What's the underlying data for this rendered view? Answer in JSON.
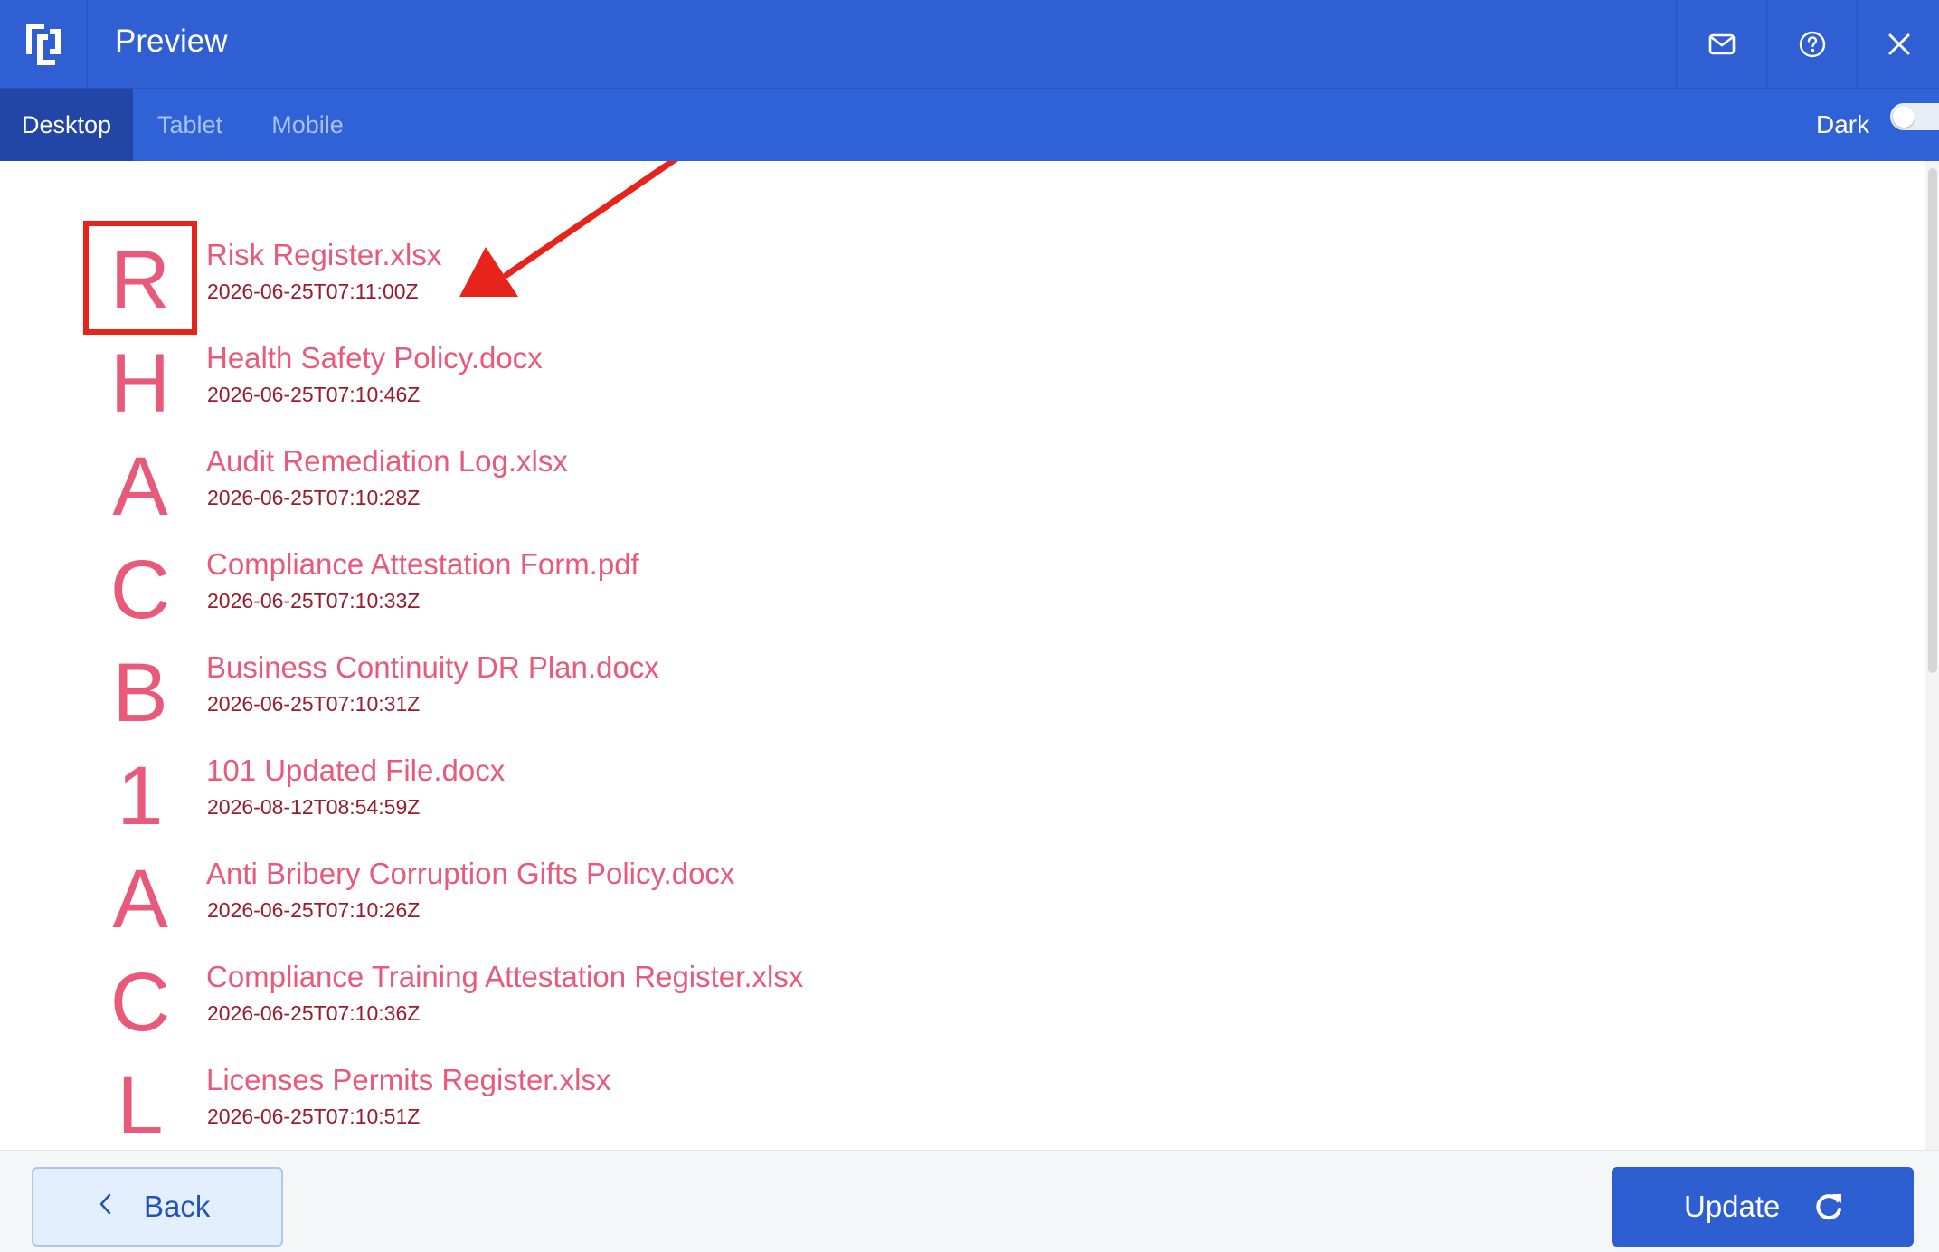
{
  "window": {
    "title": "Preview",
    "icons": {
      "logo": "app-logo-icon",
      "mail": "mail-icon",
      "help": "help-icon",
      "close": "close-icon"
    }
  },
  "tabs": [
    {
      "label": "Desktop",
      "active": true
    },
    {
      "label": "Tablet",
      "active": false
    },
    {
      "label": "Mobile",
      "active": false
    }
  ],
  "theme_toggle": {
    "label": "Dark",
    "on": false
  },
  "files": [
    {
      "letter": "R",
      "name": "Risk Register.xlsx",
      "date": "2026-06-25T07:11:00Z"
    },
    {
      "letter": "H",
      "name": "Health Safety Policy.docx",
      "date": "2026-06-25T07:10:46Z"
    },
    {
      "letter": "A",
      "name": "Audit Remediation Log.xlsx",
      "date": "2026-06-25T07:10:28Z"
    },
    {
      "letter": "C",
      "name": "Compliance Attestation Form.pdf",
      "date": "2026-06-25T07:10:33Z"
    },
    {
      "letter": "B",
      "name": "Business Continuity DR Plan.docx",
      "date": "2026-06-25T07:10:31Z"
    },
    {
      "letter": "1",
      "name": "101 Updated File.docx",
      "date": "2026-08-12T08:54:59Z"
    },
    {
      "letter": "A",
      "name": "Anti Bribery Corruption Gifts Policy.docx",
      "date": "2026-06-25T07:10:26Z"
    },
    {
      "letter": "C",
      "name": "Compliance Training Attestation Register.xlsx",
      "date": "2026-06-25T07:10:36Z"
    },
    {
      "letter": "L",
      "name": "Licenses Permits Register.xlsx",
      "date": "2026-06-25T07:10:51Z"
    }
  ],
  "footer": {
    "back_label": "Back",
    "update_label": "Update"
  },
  "colors": {
    "header": "#2f5fd3",
    "tabbar": "#2e62d6",
    "accent_pink": "#e8597a",
    "date_red": "#9b1b2c",
    "annotation_red": "#e8231b",
    "update_button": "#2e5fd1"
  }
}
